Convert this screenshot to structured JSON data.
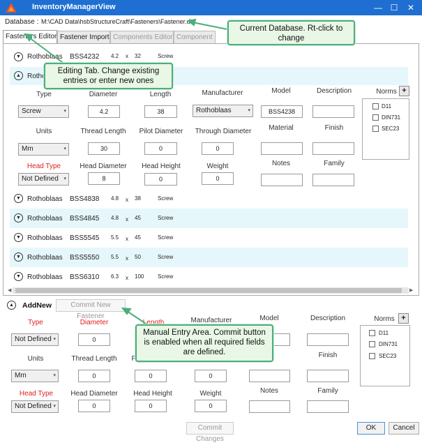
{
  "window": {
    "title": "InventoryManagerView",
    "minimize": "—",
    "maximize": "☐",
    "close": "✕"
  },
  "database": {
    "label": "Database :",
    "path": "M:\\CAD Data\\hsbStructureCraft\\Fasteners\\Fastener.db"
  },
  "tabs": [
    {
      "label": "Fasteners Editor"
    },
    {
      "label": "Fastener Import"
    },
    {
      "label": "Components Editor"
    },
    {
      "label": "Component Imp"
    }
  ],
  "rows": [
    {
      "maker": "Rothoblaas",
      "code": "BSS4232",
      "d": "4.2",
      "x": "x",
      "len": "32",
      "type": "Screw"
    },
    {
      "maker": "Rothoblaas"
    },
    {
      "maker": "Rothoblaas",
      "code": "BSS4838",
      "d": "4.8",
      "x": "x",
      "len": "38",
      "type": "Screw"
    },
    {
      "maker": "Rothoblaas",
      "code": "BSS4845",
      "d": "4.8",
      "x": "x",
      "len": "45",
      "type": "Screw"
    },
    {
      "maker": "Rothoblaas",
      "code": "BSS5545",
      "d": "5.5",
      "x": "x",
      "len": "45",
      "type": "Screw"
    },
    {
      "maker": "Rothoblaas",
      "code": "BSS5550",
      "d": "5.5",
      "x": "x",
      "len": "50",
      "type": "Screw"
    },
    {
      "maker": "Rothoblaas",
      "code": "BSS6310",
      "d": "6.3",
      "x": "x",
      "len": "100",
      "type": "Screw"
    }
  ],
  "editor": {
    "labels": {
      "type": "Type",
      "diameter": "Diameter",
      "length": "Length",
      "manufacturer": "Manufacturer",
      "model": "Model",
      "description": "Description",
      "norms": "Norms",
      "units": "Units",
      "thread_length": "Thread Length",
      "pilot_diameter": "Pilot Diameter",
      "through_diameter": "Through Diameter",
      "material": "Material",
      "finish": "Finish",
      "head_type": "Head Type",
      "head_diameter": "Head Diameter",
      "head_height": "Head Height",
      "weight": "Weight",
      "notes": "Notes",
      "family": "Family"
    },
    "values": {
      "type": "Screw",
      "diameter": "4.2",
      "length": "38",
      "manufacturer": "Rothoblaas",
      "model": "BSS4238",
      "description": "",
      "units": "Mm",
      "thread_length": "30",
      "pilot_diameter": "0",
      "through_diameter": "0",
      "material": "",
      "finish": "",
      "head_type": "Not Defined",
      "head_diameter": "8",
      "head_height": "0",
      "weight": "0",
      "notes": "",
      "family": ""
    },
    "norms": [
      "D11",
      "DIN731",
      "SEC23"
    ],
    "norms_add": "+"
  },
  "addnew": {
    "title": "AddNew",
    "commit_button": "Commit New Fastener",
    "labels": {
      "type": "Type",
      "diameter": "Diameter",
      "length": "Length",
      "manufacturer": "Manufacturer",
      "model": "Model",
      "description": "Description",
      "norms": "Norms",
      "units": "Units",
      "thread_length": "Thread Length",
      "pilot": "Pi",
      "material": "erial",
      "finish": "Finish",
      "head_type": "Head Type",
      "head_diameter": "Head Diameter",
      "head_height": "Head Height",
      "weight": "Weight",
      "notes": "Notes",
      "family": "Family"
    },
    "values": {
      "type": "Not Defined",
      "diameter": "0",
      "units": "Mm",
      "thread_length": "0",
      "pilot": "0",
      "through": "0",
      "head_type": "Not Defined",
      "head_diameter": "0",
      "head_height": "0",
      "weight": "0"
    },
    "norms": [
      "D11",
      "DIN731",
      "SEC23"
    ],
    "norms_add": "+"
  },
  "footer": {
    "commit_changes": "Commit Changes",
    "ok": "OK",
    "cancel": "Cancel"
  },
  "callouts": {
    "database": "Current Database. Rt-click to change",
    "editing": "Editing Tab. Change existing entries or enter new ones",
    "manual": "Manual Entry Area. Commit button is enabled when all required fields are defined."
  },
  "colors": {
    "titlebar": "#1E6FD1",
    "row_alt": "#E6F7FB",
    "required_label": "#E02020",
    "callout_bg": "#E8F7E6",
    "callout_border": "#4DAE7A"
  }
}
